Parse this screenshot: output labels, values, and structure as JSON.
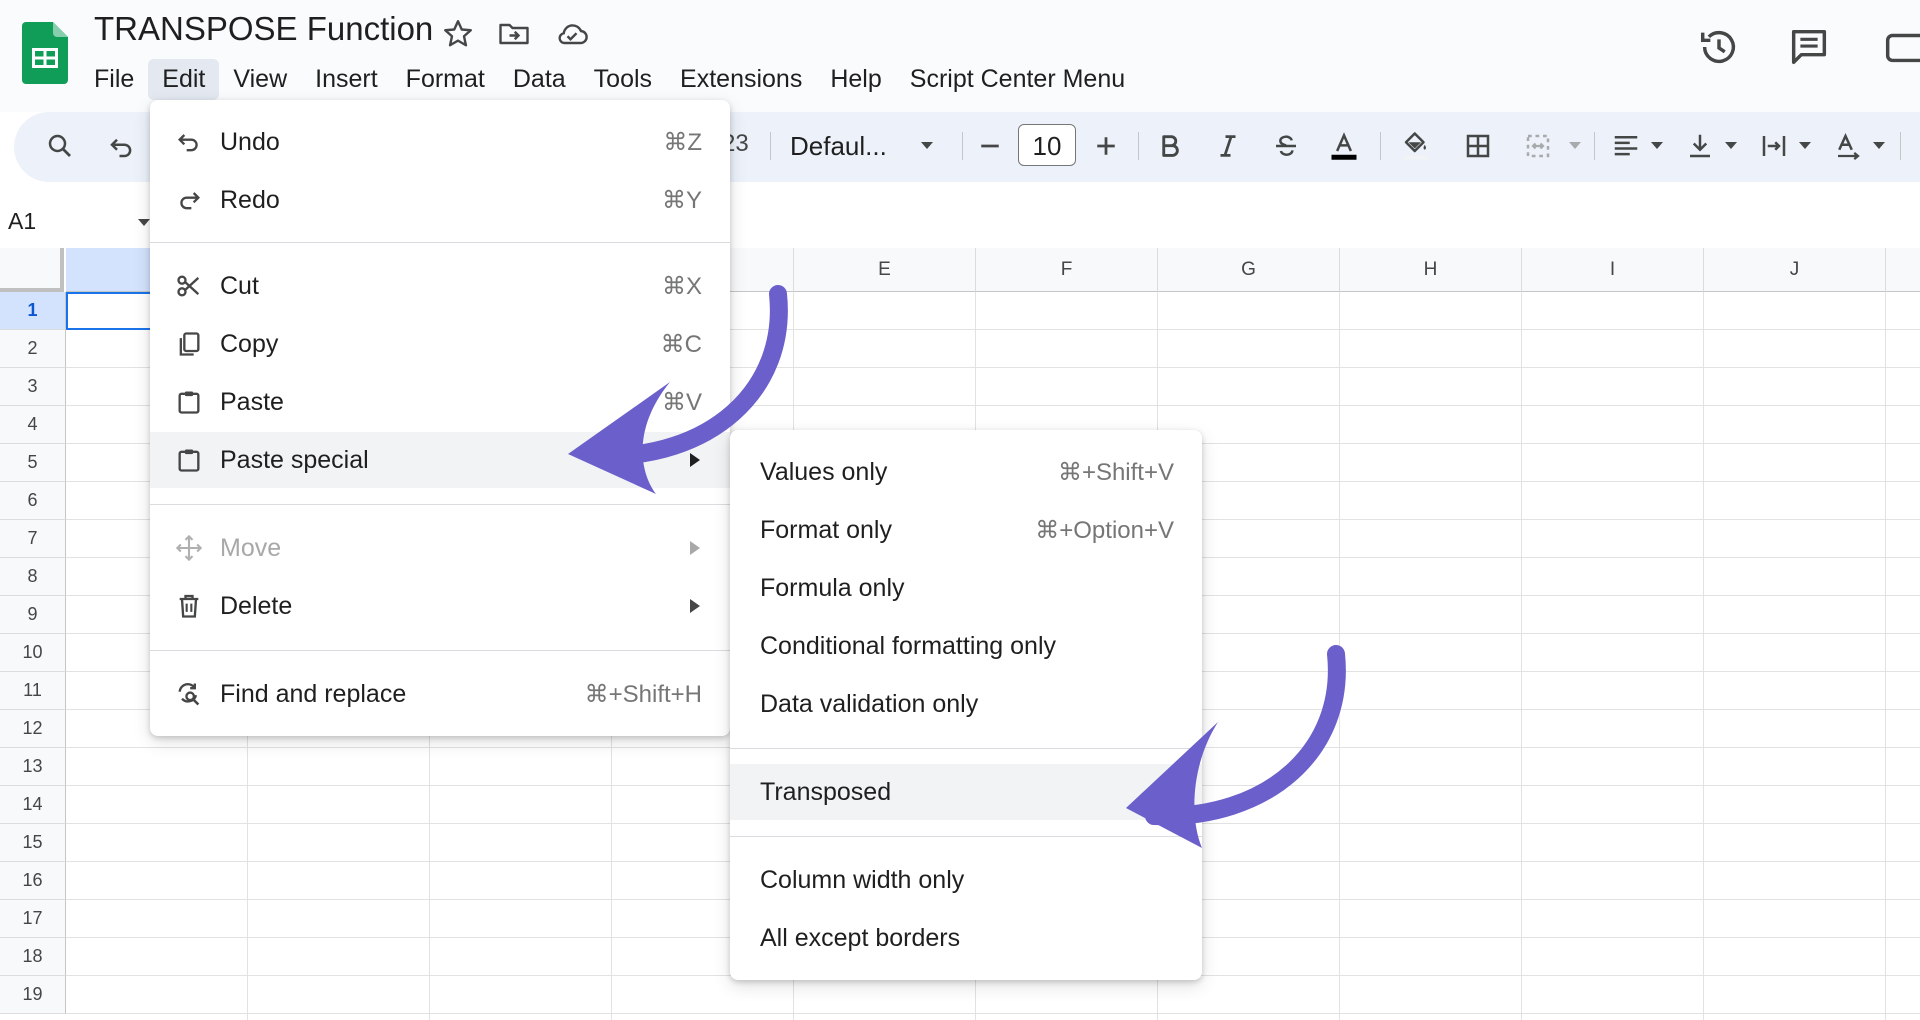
{
  "app": {
    "doc_title": "TRANSPOSE Function",
    "menus": [
      "File",
      "Edit",
      "View",
      "Insert",
      "Format",
      "Data",
      "Tools",
      "Extensions",
      "Help",
      "Script Center Menu"
    ],
    "active_menu": "Edit"
  },
  "toolbar": {
    "number_format_fragment": "23",
    "font_name": "Defaul...",
    "font_size": "10"
  },
  "formula_bar": {
    "name_box": "A1"
  },
  "grid": {
    "columns": [
      "E",
      "F",
      "G",
      "H",
      "I",
      "J"
    ],
    "rows": [
      "1",
      "2",
      "3",
      "4",
      "5",
      "6",
      "7",
      "8",
      "9",
      "10",
      "11",
      "12",
      "13",
      "14",
      "15",
      "16",
      "17",
      "18",
      "19"
    ],
    "active_cell": "A1"
  },
  "edit_menu": {
    "items": [
      {
        "label": "Undo",
        "shortcut": "⌘Z",
        "icon": "undo-icon"
      },
      {
        "label": "Redo",
        "shortcut": "⌘Y",
        "icon": "redo-icon"
      },
      {
        "label": "Cut",
        "shortcut": "⌘X",
        "icon": "scissors-icon"
      },
      {
        "label": "Copy",
        "shortcut": "⌘C",
        "icon": "copy-icon"
      },
      {
        "label": "Paste",
        "shortcut": "⌘V",
        "icon": "clipboard-icon"
      },
      {
        "label": "Paste special",
        "shortcut": "",
        "icon": "clipboard-icon",
        "submenu": true,
        "highlighted": true
      },
      {
        "label": "Move",
        "shortcut": "",
        "icon": "move-icon",
        "submenu": true,
        "disabled": true
      },
      {
        "label": "Delete",
        "shortcut": "",
        "icon": "trash-icon",
        "submenu": true
      },
      {
        "label": "Find and replace",
        "shortcut": "⌘+Shift+H",
        "icon": "find-replace-icon"
      }
    ]
  },
  "paste_special_menu": {
    "items": [
      {
        "label": "Values only",
        "shortcut": "⌘+Shift+V"
      },
      {
        "label": "Format only",
        "shortcut": "⌘+Option+V"
      },
      {
        "label": "Formula only",
        "shortcut": ""
      },
      {
        "label": "Conditional formatting only",
        "shortcut": ""
      },
      {
        "label": "Data validation only",
        "shortcut": ""
      },
      {
        "label": "Transposed",
        "shortcut": "",
        "highlighted": true
      },
      {
        "label": "Column width only",
        "shortcut": ""
      },
      {
        "label": "All except borders",
        "shortcut": ""
      }
    ]
  },
  "colors": {
    "accent": "#1a73e8",
    "annotation_arrow": "#6b5fcb",
    "sheets_green": "#0f9d58",
    "toolbar_bg": "#edf2fa"
  }
}
